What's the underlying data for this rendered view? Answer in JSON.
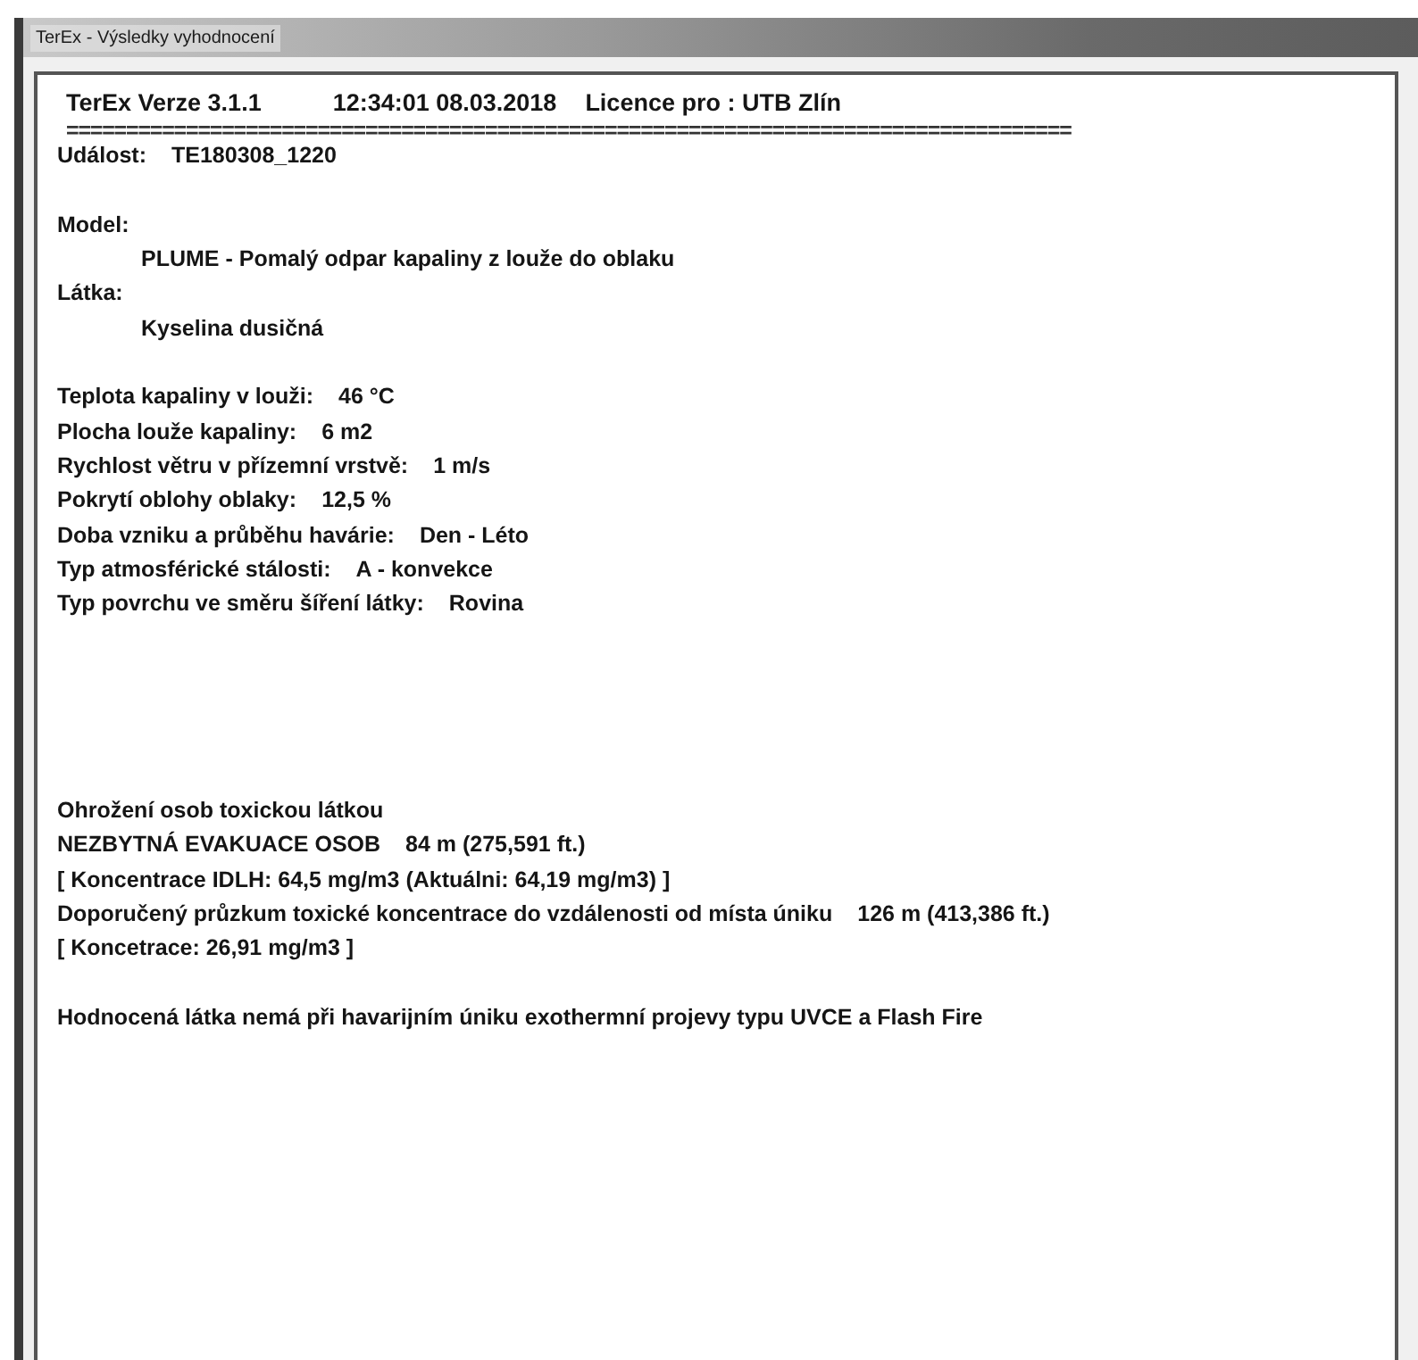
{
  "window": {
    "title": "TerEx - Výsledky vyhodnocení"
  },
  "lines": [
    {
      "kind": "header",
      "parts": [
        "TerEx  Verze 3.1.1",
        "12:34:01  08.03.2018",
        "Licence pro : UTB Zlín"
      ]
    },
    {
      "kind": "separator",
      "text": "===================================================================================="
    },
    {
      "kind": "field",
      "text": "Událost:",
      "value": "TE180308_1220"
    },
    {
      "kind": "blank"
    },
    {
      "kind": "field",
      "text": "Model:"
    },
    {
      "kind": "indented",
      "text": "PLUME - Pomalý odpar kapaliny z louže do oblaku"
    },
    {
      "kind": "field",
      "text": "Látka:"
    },
    {
      "kind": "indented",
      "text": "Kyselina dusičná"
    },
    {
      "kind": "blank"
    },
    {
      "kind": "field",
      "text": "Teplota kapaliny v louži:",
      "value": "46 °C"
    },
    {
      "kind": "field",
      "text": "Plocha louže kapaliny:",
      "value": "6 m2"
    },
    {
      "kind": "field",
      "text": "Rychlost větru v přízemní vrstvě:",
      "value": "1 m/s"
    },
    {
      "kind": "field",
      "text": "Pokrytí oblohy oblaky:",
      "value": "12,5 %"
    },
    {
      "kind": "field",
      "text": "Doba vzniku a průběhu havárie:",
      "value": "Den - Léto"
    },
    {
      "kind": "field",
      "text": "Typ atmosférické stálosti:",
      "value": "A - konvekce"
    },
    {
      "kind": "field",
      "text": "Typ povrchu ve směru šíření látky:",
      "value": "Rovina"
    },
    {
      "kind": "blank"
    },
    {
      "kind": "blank"
    },
    {
      "kind": "blank"
    },
    {
      "kind": "blank"
    },
    {
      "kind": "blank"
    },
    {
      "kind": "field",
      "text": "Ohrožení osob toxickou látkou"
    },
    {
      "kind": "field",
      "text": "NEZBYTNÁ EVAKUACE OSOB",
      "value": "84 m (275,591 ft.)"
    },
    {
      "kind": "field",
      "text": "[ Koncentrace IDLH: 64,5 mg/m3 (Aktuálni: 64,19 mg/m3) ]"
    },
    {
      "kind": "field",
      "text": "Doporučený průzkum toxické koncentrace do vzdálenosti od místa úniku",
      "value": "126 m (413,386 ft.)"
    },
    {
      "kind": "field",
      "text": "[ Koncetrace: 26,91 mg/m3 ]"
    },
    {
      "kind": "blank"
    },
    {
      "kind": "field",
      "text": "Hodnocená látka nemá při havarijním úniku exothermní projevy typu UVCE a Flash Fire"
    }
  ]
}
